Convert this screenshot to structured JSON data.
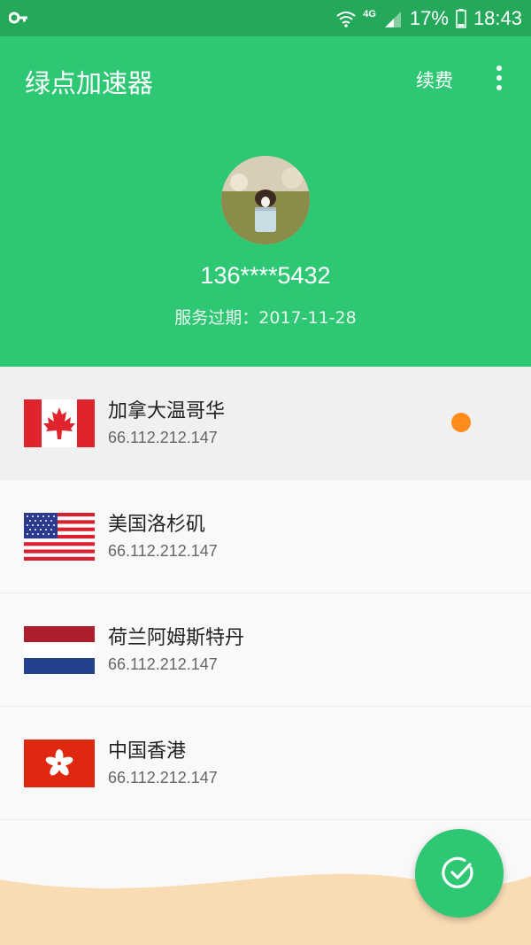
{
  "status_bar": {
    "network": "4G",
    "battery_percent": "17%",
    "time": "18:43",
    "icons": [
      "key-icon",
      "wifi-icon",
      "signal-icon",
      "battery-icon"
    ]
  },
  "header": {
    "title": "绿点加速器",
    "renew_label": "续费",
    "more_icon": "more-vertical-icon",
    "phone": "136****5432",
    "expire_label": "服务过期：",
    "expire_date": "2017-11-28"
  },
  "servers": [
    {
      "name": "加拿大温哥华",
      "ip": "66.112.212.147",
      "flag": "canada-flag-icon",
      "selected": true
    },
    {
      "name": "美国洛杉矶",
      "ip": "66.112.212.147",
      "flag": "usa-flag-icon",
      "selected": false
    },
    {
      "name": "荷兰阿姆斯特丹",
      "ip": "66.112.212.147",
      "flag": "netherlands-flag-icon",
      "selected": false
    },
    {
      "name": "中国香港",
      "ip": "66.112.212.147",
      "flag": "hong-kong-flag-icon",
      "selected": false
    }
  ],
  "fab": {
    "icon": "check-circle-icon"
  },
  "colors": {
    "primary": "#2ec774",
    "status_bar": "#24a85a",
    "active_dot": "#ff8c1a",
    "wave": "#fadcb4"
  }
}
